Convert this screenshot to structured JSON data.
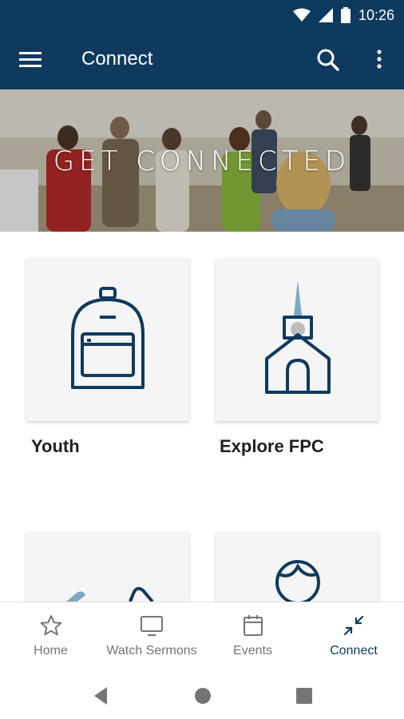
{
  "status_bar": {
    "time": "10:26",
    "icons": [
      "wifi-icon",
      "cell-signal-icon",
      "battery-icon"
    ]
  },
  "app_bar": {
    "title": "Connect",
    "background": "#0f3a5f",
    "left_icon": "hamburger-menu-icon",
    "right_icons": [
      "search-icon",
      "more-vert-icon"
    ]
  },
  "hero": {
    "title": "GET CONNECTED"
  },
  "tiles": [
    {
      "label": "Youth",
      "icon": "backpack-icon"
    },
    {
      "label": "Explore FPC",
      "icon": "church-icon"
    },
    {
      "label": "",
      "icon": "partial-icon"
    },
    {
      "label": "",
      "icon": "person-face-icon"
    }
  ],
  "bottom_nav": {
    "items": [
      {
        "label": "Home",
        "icon": "star-icon",
        "active": false
      },
      {
        "label": "Watch Sermons",
        "icon": "tv-icon",
        "active": false
      },
      {
        "label": "Events",
        "icon": "calendar-icon",
        "active": false
      },
      {
        "label": "Connect",
        "icon": "connect-arrows-icon",
        "active": true
      }
    ],
    "active_color": "#0f3a5f",
    "inactive_color": "#757575"
  },
  "system_nav": {
    "buttons": [
      "back-icon",
      "home-icon",
      "recents-icon"
    ]
  }
}
